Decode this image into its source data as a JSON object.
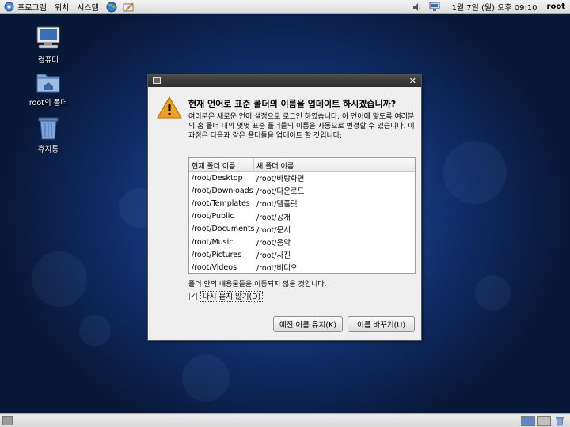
{
  "top_panel": {
    "menu": [
      {
        "label": "프로그램"
      },
      {
        "label": "위치"
      },
      {
        "label": "시스템"
      }
    ],
    "clock": "1월  7일 (월) 오후 09:10",
    "user": "root"
  },
  "desktop": {
    "icons": [
      {
        "label": "컴퓨터"
      },
      {
        "label": "root의 폴더"
      },
      {
        "label": "휴지통"
      }
    ]
  },
  "dialog": {
    "title": "",
    "heading": "현재 언어로 표준 폴더의 이름을 업데이트 하시겠습니까?",
    "description": "여러분은 새로운 언어 설정으로 로그인 하였습니다. 이 언어에 맞도록 여러분의 홈 폴더 내의 몇몇 표준 폴더들의 이름을 자동으로 변경할 수 있습니다. 이 과정은 다음과 같은 폴더들을 업데이트 할 것입니다:",
    "columns": [
      "현재 폴더 이름",
      "새 폴더 이름"
    ],
    "rows": [
      [
        "/root/Desktop",
        "/root/바탕화면"
      ],
      [
        "/root/Downloads",
        "/root/다운로드"
      ],
      [
        "/root/Templates",
        "/root/템플릿"
      ],
      [
        "/root/Public",
        "/root/공개"
      ],
      [
        "/root/Documents",
        "/root/문서"
      ],
      [
        "/root/Music",
        "/root/음악"
      ],
      [
        "/root/Pictures",
        "/root/사진"
      ],
      [
        "/root/Videos",
        "/root/비디오"
      ]
    ],
    "note": "폴더 안의 내용물들을 이동되지 않을 것입니다.",
    "checkbox": {
      "label": "다시 묻지 않기(D)",
      "checked": true
    },
    "buttons": {
      "keep": "예전 이름 유지(K)",
      "rename": "이름 바꾸기(U)"
    }
  },
  "colors": {
    "desktop_blue": "#1a3f86",
    "titlebar": "#2c2c2c",
    "warning": "#f0a020"
  }
}
